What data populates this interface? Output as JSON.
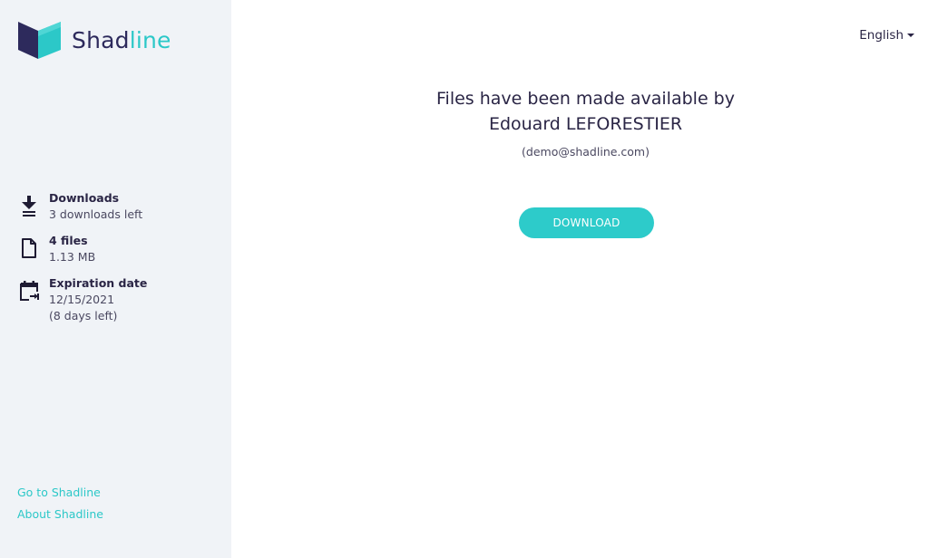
{
  "brand": {
    "name_part1": "Shad",
    "name_part2": "line",
    "logo_icon": "book-logo-icon",
    "color_dark": "#2d2a5c",
    "color_accent": "#2cc8c8"
  },
  "sidebar": {
    "items": [
      {
        "icon": "download-icon",
        "title": "Downloads",
        "lines": [
          "3 downloads left"
        ]
      },
      {
        "icon": "file-icon",
        "title": "4 files",
        "lines": [
          "1.13 MB"
        ]
      },
      {
        "icon": "calendar-expiry-icon",
        "title": "Expiration date",
        "lines": [
          "12/15/2021",
          "(8 days left)"
        ]
      }
    ],
    "links": [
      {
        "label": "Go to Shadline"
      },
      {
        "label": "About Shadline"
      }
    ]
  },
  "header": {
    "language": "English"
  },
  "main": {
    "headline_line1": "Files have been made available by",
    "headline_line2": "Edouard LEFORESTIER",
    "email": "(demo@shadline.com)",
    "download_label": "DOWNLOAD"
  }
}
